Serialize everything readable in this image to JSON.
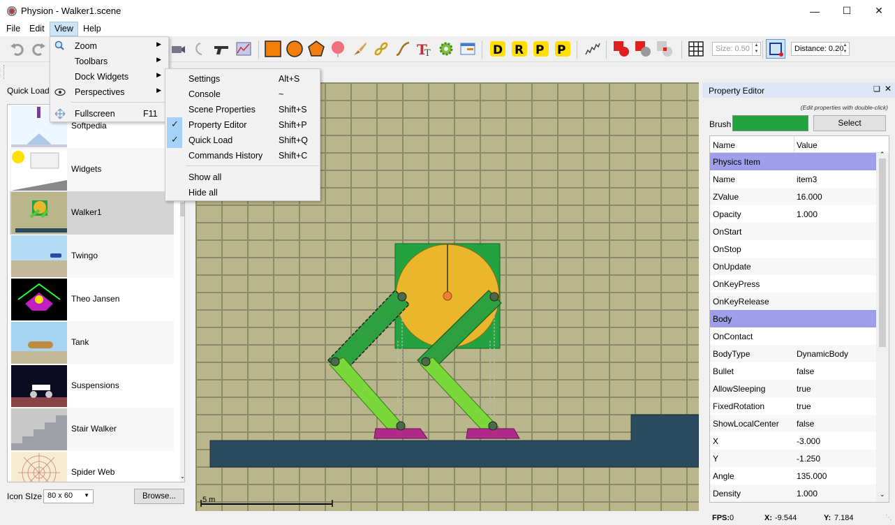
{
  "window": {
    "title": "Physion - Walker1.scene"
  },
  "menubar": [
    "File",
    "Edit",
    "View",
    "Help"
  ],
  "view_menu": [
    {
      "label": "Zoom",
      "submenu": true,
      "icon": "magnifier-icon"
    },
    {
      "label": "Toolbars",
      "submenu": true
    },
    {
      "label": "Dock Widgets",
      "submenu": true
    },
    {
      "label": "Perspectives",
      "submenu": true,
      "icon": "eye-icon"
    },
    {
      "label": "Fullscreen",
      "shortcut": "F11",
      "icon": "fullscreen-icon"
    }
  ],
  "dock_menu": [
    {
      "label": "Settings",
      "shortcut": "Alt+S",
      "checked": false
    },
    {
      "label": "Console",
      "shortcut": "~",
      "checked": false
    },
    {
      "label": "Scene Properties",
      "shortcut": "Shift+S",
      "checked": false
    },
    {
      "label": "Property Editor",
      "shortcut": "Shift+P",
      "checked": true
    },
    {
      "label": "Quick Load",
      "shortcut": "Shift+Q",
      "checked": true
    },
    {
      "label": "Commands History",
      "shortcut": "Shift+C",
      "checked": false
    },
    {
      "label": "Show all",
      "shortcut": "",
      "checked": false
    },
    {
      "label": "Hide all",
      "shortcut": "",
      "checked": false
    }
  ],
  "toolbar": {
    "letters": [
      "D",
      "R",
      "P",
      "P"
    ],
    "size_value": "Size: 0.50",
    "distance_value": "Distance: 0.20"
  },
  "quick_load": {
    "title": "Quick Load",
    "items": [
      "Softpedia",
      "Widgets",
      "Walker1",
      "Twingo",
      "Theo Jansen",
      "Tank",
      "Suspensions",
      "Stair Walker",
      "Spider Web"
    ],
    "selected": "Walker1",
    "icon_size_label": "Icon SIze",
    "icon_size_value": "80 x 60",
    "browse_label": "Browse..."
  },
  "canvas": {
    "scale_label": "5 m"
  },
  "property_editor": {
    "title": "Property Editor",
    "hint": "(Edit properties with double-click)",
    "brush_label": "Brush",
    "brush_color": "#22a340",
    "select_label": "Select",
    "col_name": "Name",
    "col_value": "Value",
    "rows": [
      {
        "k": "Physics Item",
        "v": "",
        "section": true
      },
      {
        "k": "Name",
        "v": "item3"
      },
      {
        "k": "ZValue",
        "v": "16.000"
      },
      {
        "k": "Opacity",
        "v": "1.000"
      },
      {
        "k": "OnStart",
        "v": ""
      },
      {
        "k": "OnStop",
        "v": ""
      },
      {
        "k": "OnUpdate",
        "v": ""
      },
      {
        "k": "OnKeyPress",
        "v": ""
      },
      {
        "k": "OnKeyRelease",
        "v": ""
      },
      {
        "k": "Body",
        "v": "",
        "section": true
      },
      {
        "k": "OnContact",
        "v": ""
      },
      {
        "k": "BodyType",
        "v": "DynamicBody"
      },
      {
        "k": "Bullet",
        "v": "false"
      },
      {
        "k": "AllowSleeping",
        "v": "true"
      },
      {
        "k": "FixedRotation",
        "v": "true"
      },
      {
        "k": "ShowLocalCenter",
        "v": "false"
      },
      {
        "k": "X",
        "v": "-3.000"
      },
      {
        "k": "Y",
        "v": "-1.250"
      },
      {
        "k": "Angle",
        "v": "135.000"
      },
      {
        "k": "Density",
        "v": "1.000"
      }
    ]
  },
  "status": {
    "fps_label": "FPS:",
    "fps_value": "0",
    "x_label": "X:",
    "x_value": "-9.544",
    "y_label": "Y:",
    "y_value": "7.184"
  },
  "colors": {
    "accent": "#91c9f7",
    "section": "#9e9eea",
    "ground": "#2c4a5e",
    "wheel": "#e9b62c"
  }
}
